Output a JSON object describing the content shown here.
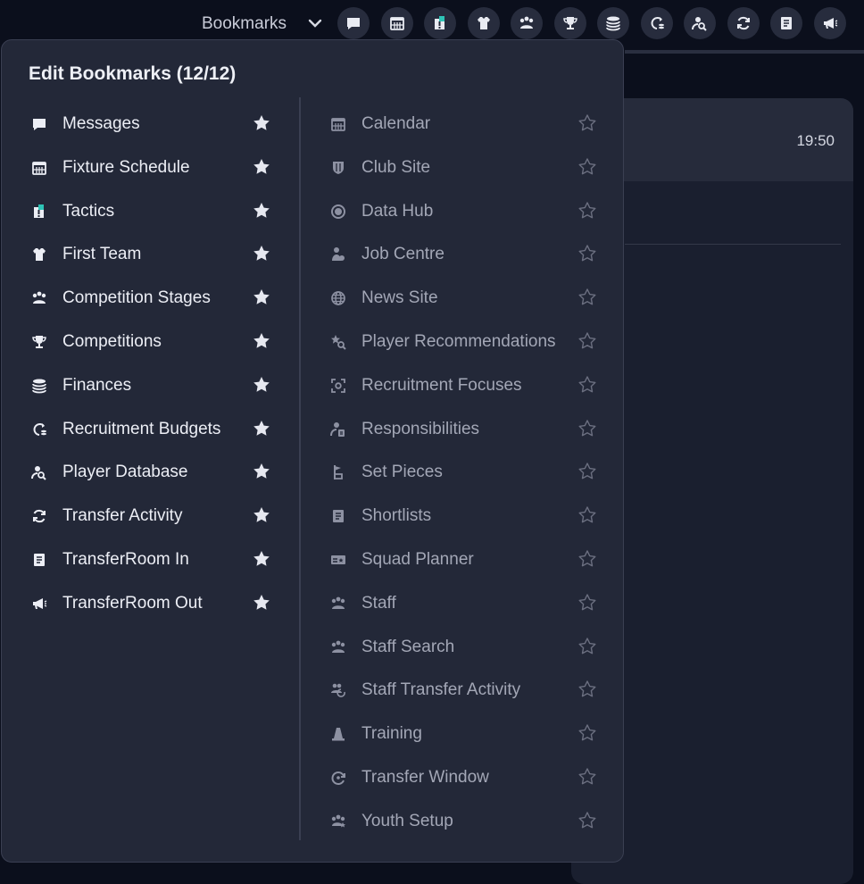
{
  "topbar": {
    "bookmarks_label": "Bookmarks",
    "icons": [
      "message-icon",
      "calendar-icon",
      "tactics-icon",
      "shirt-icon",
      "competition-stages-icon",
      "trophy-icon",
      "coins-icon",
      "recruitment-budget-icon",
      "player-search-icon",
      "refresh-icon",
      "document-icon",
      "megaphone-icon"
    ]
  },
  "background": {
    "time": "19:50"
  },
  "panel": {
    "title": "Edit Bookmarks (12/12)",
    "bookmarked": [
      {
        "label": "Messages",
        "icon": "message-icon"
      },
      {
        "label": "Fixture Schedule",
        "icon": "calendar-icon"
      },
      {
        "label": "Tactics",
        "icon": "tactics-icon"
      },
      {
        "label": "First Team",
        "icon": "shirt-icon"
      },
      {
        "label": "Competition Stages",
        "icon": "competition-stages-icon"
      },
      {
        "label": "Competitions",
        "icon": "trophy-icon"
      },
      {
        "label": "Finances",
        "icon": "coins-icon"
      },
      {
        "label": "Recruitment Budgets",
        "icon": "recruitment-budget-icon"
      },
      {
        "label": "Player Database",
        "icon": "player-search-icon"
      },
      {
        "label": "Transfer Activity",
        "icon": "refresh-icon"
      },
      {
        "label": "TransferRoom In",
        "icon": "document-icon"
      },
      {
        "label": "TransferRoom Out",
        "icon": "megaphone-icon"
      }
    ],
    "available": [
      {
        "label": "Calendar",
        "icon": "calendar-icon"
      },
      {
        "label": "Club Site",
        "icon": "shield-icon"
      },
      {
        "label": "Data Hub",
        "icon": "data-hub-icon"
      },
      {
        "label": "Job Centre",
        "icon": "job-centre-icon"
      },
      {
        "label": "News Site",
        "icon": "globe-icon"
      },
      {
        "label": "Player Recommendations",
        "icon": "star-search-icon"
      },
      {
        "label": "Recruitment Focuses",
        "icon": "focus-icon"
      },
      {
        "label": "Responsibilities",
        "icon": "responsibilities-icon"
      },
      {
        "label": "Set Pieces",
        "icon": "set-pieces-icon"
      },
      {
        "label": "Shortlists",
        "icon": "document-icon"
      },
      {
        "label": "Squad Planner",
        "icon": "squad-planner-icon"
      },
      {
        "label": "Staff",
        "icon": "staff-icon"
      },
      {
        "label": "Staff Search",
        "icon": "staff-search-icon"
      },
      {
        "label": "Staff Transfer Activity",
        "icon": "staff-transfer-icon"
      },
      {
        "label": "Training",
        "icon": "cone-icon"
      },
      {
        "label": "Transfer Window",
        "icon": "transfer-window-icon"
      },
      {
        "label": "Youth Setup",
        "icon": "youth-setup-icon"
      }
    ]
  },
  "colors": {
    "background": "#0b0f1c",
    "panel": "#232838",
    "accent_teal": "#2ec4b6",
    "star_filled": "#e6e8f0",
    "star_empty": "#6b6f80"
  }
}
